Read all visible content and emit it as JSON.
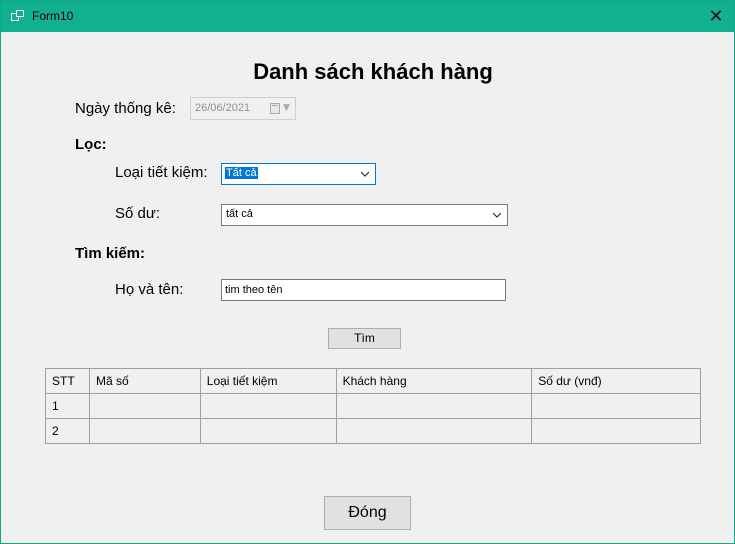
{
  "window": {
    "title": "Form10",
    "close_glyph": "✕",
    "accent_color": "#11b08f"
  },
  "form": {
    "heading": "Danh sách khách hàng",
    "date_label": "Ngày thống kê:",
    "date_value": "26/06/2021",
    "filter_heading": "Lọc:",
    "savings_type_label": "Loại tiết kiệm:",
    "savings_type_value": "Tất cả",
    "balance_label": "Số dư:",
    "balance_value": "tất cả",
    "search_heading": "Tìm kiếm:",
    "name_label": "Họ và tên:",
    "name_value": "tim theo tên",
    "search_button": "Tìm",
    "close_button": "Đóng"
  },
  "table": {
    "columns": [
      "STT",
      "Mã số",
      "Loại tiết kiệm",
      "Khách hàng",
      "Số dư (vnđ)"
    ],
    "rows": [
      [
        "1",
        "",
        "",
        "",
        ""
      ],
      [
        "2",
        "",
        "",
        "",
        ""
      ]
    ]
  }
}
